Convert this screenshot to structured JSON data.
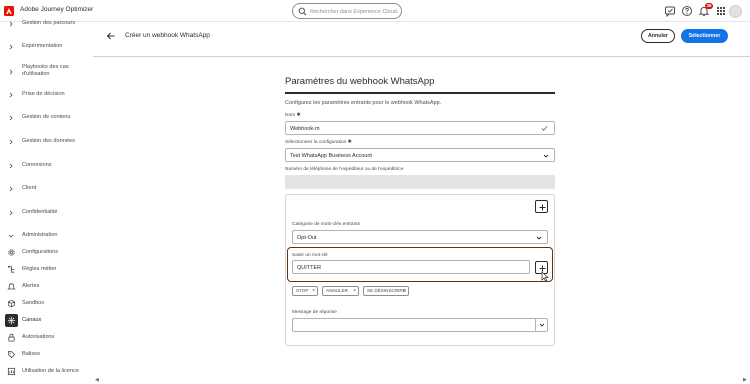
{
  "header": {
    "app_title": "Adobe Journey Optimizer",
    "search_placeholder": "Rechercher dans Experience Cloud...",
    "notification_count": "36"
  },
  "sidebar": {
    "items": [
      {
        "label": "Gestion des parcours",
        "icon": "chevron-right-icon"
      },
      {
        "label": "Expérimentation",
        "icon": "chevron-right-icon"
      },
      {
        "label": "Playbooks des cas d'utilisation",
        "icon": "chevron-right-icon"
      },
      {
        "label": "Prise de décision",
        "icon": "chevron-right-icon"
      },
      {
        "label": "Gestion de contenu",
        "icon": "chevron-right-icon"
      },
      {
        "label": "Gestion des données",
        "icon": "chevron-right-icon"
      },
      {
        "label": "Connexions",
        "icon": "chevron-right-icon"
      },
      {
        "label": "Client",
        "icon": "chevron-right-icon"
      },
      {
        "label": "Confidentialité",
        "icon": "chevron-right-icon"
      },
      {
        "label": "Administration",
        "icon": "chevron-down-icon"
      },
      {
        "label": "Configurations",
        "icon": "gear-icon"
      },
      {
        "label": "Règles métier",
        "icon": "rules-icon"
      },
      {
        "label": "Alertes",
        "icon": "bell-icon"
      },
      {
        "label": "Sandbox",
        "icon": "box-icon"
      },
      {
        "label": "Canaux",
        "icon": "channels-icon"
      },
      {
        "label": "Autorisations",
        "icon": "lock-icon"
      },
      {
        "label": "Balises",
        "icon": "tag-icon"
      },
      {
        "label": "Utilisation de la licence",
        "icon": "chart-icon"
      }
    ]
  },
  "page": {
    "title": "Créer un webhook WhatsApp",
    "cancel_label": "Annuler",
    "select_label": "Sélectionner"
  },
  "form": {
    "title": "Paramètres du webhook WhatsApp",
    "description": "Configurez les paramètres entrants pour le webhook WhatsApp.",
    "name_label": "Nom ✱",
    "name_value": "Webhook-m",
    "config_label": "Sélectionnez la configuration ✱",
    "config_value": "Test WhatsApp Business Account",
    "phone_label": "Numéro de téléphone de l'expéditeur ou de l'expéditrice",
    "keyword_category_label": "Catégorie de mots-clés entrants",
    "keyword_category_value": "Opt-Out",
    "keyword_input_label": "Saisir un mot-clé",
    "keyword_input_value": "QUITTER",
    "tags": [
      "STOP",
      "ANNULER",
      "SE DÉSINSCRIRE"
    ],
    "reply_label": "Message de réponse",
    "reply_value": ""
  },
  "colors": {
    "accent": "#1473e6",
    "highlight_border": "#6b2d16",
    "valid_check": "#2d9d78",
    "badge": "#d31510"
  }
}
